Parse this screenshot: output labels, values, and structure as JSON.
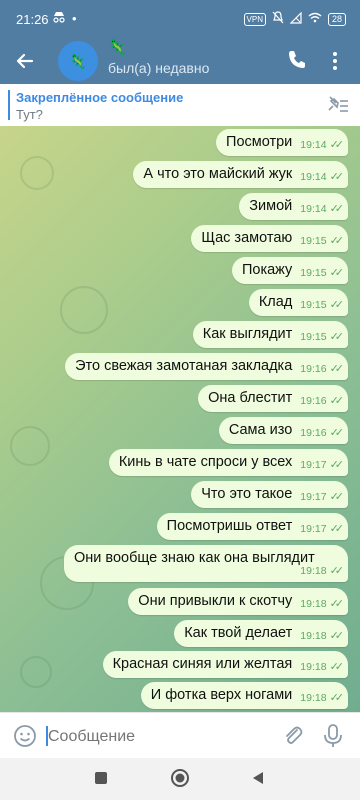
{
  "status": {
    "time": "21:26",
    "vpn": "VPN",
    "battery": "28"
  },
  "header": {
    "title_emoji": "🦎",
    "subtitle": "был(а) недавно",
    "avatar_emoji": "🦎"
  },
  "pinned": {
    "title": "Закреплённое сообщение",
    "text": "Тут?"
  },
  "messages": [
    {
      "text": "Посмотри",
      "time": "19:14"
    },
    {
      "text": "А что это майский жук",
      "time": "19:14"
    },
    {
      "text": "Зимой",
      "time": "19:14"
    },
    {
      "text": "Щас замотаю",
      "time": "19:15"
    },
    {
      "text": "Покажу",
      "time": "19:15"
    },
    {
      "text": "Клад",
      "time": "19:15"
    },
    {
      "text": "Как выглядит",
      "time": "19:15"
    },
    {
      "text": "Это свежая замотаная закладка",
      "time": "19:16"
    },
    {
      "text": "Она блестит",
      "time": "19:16"
    },
    {
      "text": "Сама изо",
      "time": "19:16"
    },
    {
      "text": "Кинь в чате спроси у всех",
      "time": "19:17"
    },
    {
      "text": "Что это такое",
      "time": "19:17"
    },
    {
      "text": "Посмотришь ответ",
      "time": "19:17"
    },
    {
      "text": "Они вообще знаю как она выглядит",
      "time": "19:18"
    },
    {
      "text": "Они привыкли к скотчу",
      "time": "19:18"
    },
    {
      "text": "Как твой делает",
      "time": "19:18"
    },
    {
      "text": "Красная синяя или желтая",
      "time": "19:18"
    },
    {
      "text": "И фотка верх ногами",
      "time": "19:18"
    }
  ],
  "composer": {
    "placeholder": "Сообщение"
  },
  "colors": {
    "accent": "#517da2",
    "bubble": "#effdde",
    "link": "#3f8ae0"
  }
}
